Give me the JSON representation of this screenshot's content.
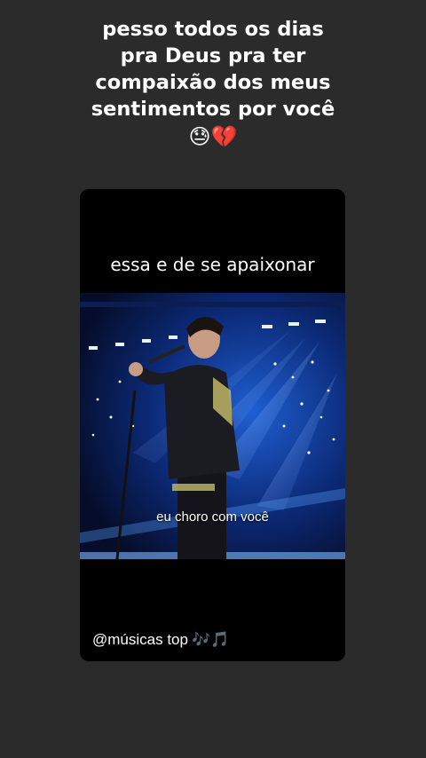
{
  "caption": {
    "lines": [
      "pesso todos os dias",
      "pra Deus pra ter",
      "compaixão dos meus",
      "sentimentos por você"
    ],
    "emojis": "😓💔"
  },
  "card": {
    "title": "essa e de se apaixonar",
    "subtitle": "eu choro com você",
    "handle": "@músicas top",
    "handle_emojis": "🎶🎵"
  }
}
